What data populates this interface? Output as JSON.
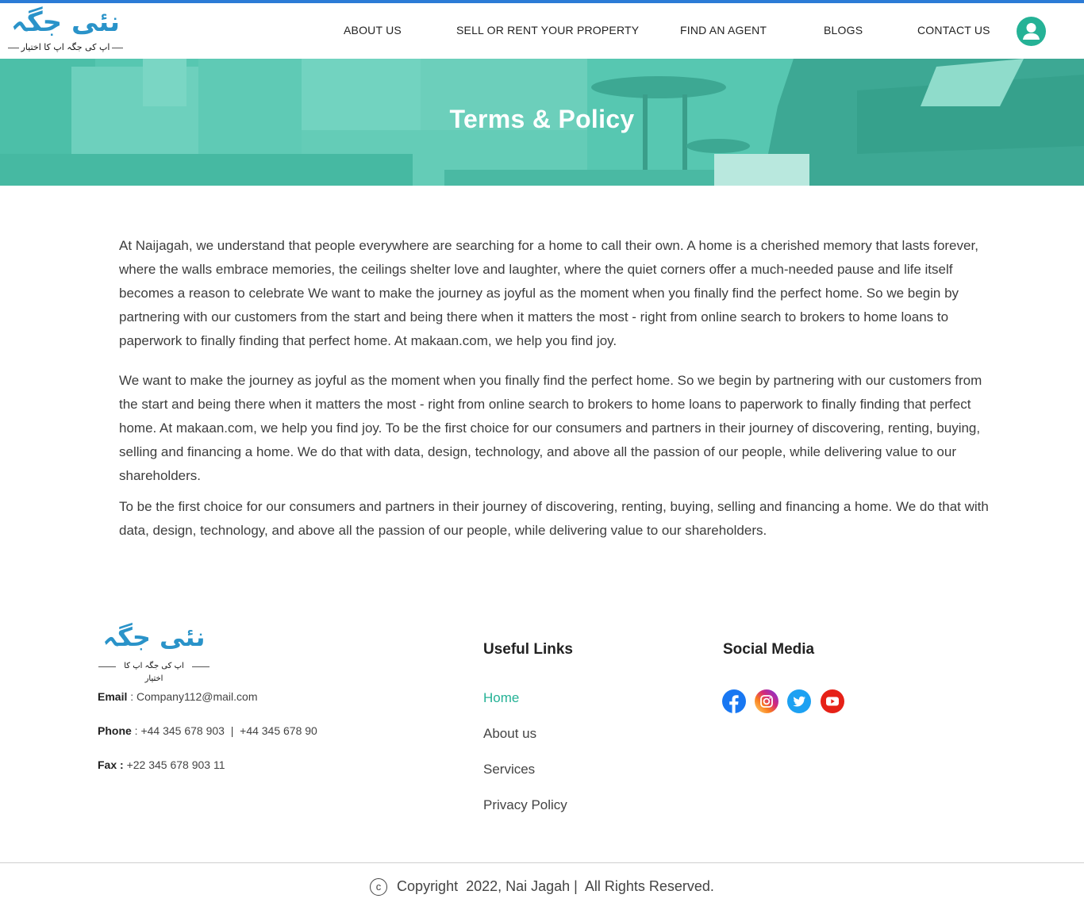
{
  "colors": {
    "brand_blue": "#2b7bd6",
    "logo_blue": "#2a93c9",
    "accent_teal": "#25b296",
    "hero_overlay": "#4fc4ad"
  },
  "header": {
    "logo": {
      "title_urdu": "نئی جگہ",
      "tagline_urdu": "اپ کی جگہ اپ کا اختیار"
    },
    "nav": [
      {
        "label": "ABOUT US"
      },
      {
        "label": "SELL OR RENT YOUR PROPERTY"
      },
      {
        "label": "FIND AN AGENT"
      },
      {
        "label": "BLOGS"
      },
      {
        "label": "CONTACT US"
      }
    ],
    "user_icon": "user-account-icon"
  },
  "hero": {
    "title": "Terms & Policy"
  },
  "content": {
    "paragraphs": [
      "At Naijagah, we understand that people everywhere are searching for a home to call their own. A home is a cherished memory that lasts forever, where the walls embrace memories, the ceilings shelter love and laughter, where the quiet corners offer a much-needed pause and life itself becomes a reason to celebrate We want to make the journey as joyful as the moment when you finally find the perfect home. So we begin by partnering with our customers from the start and being there when it matters the most - right from online search to brokers to home loans to paperwork to finally finding that perfect home. At makaan.com, we help you find joy.",
      "We want to make the journey as joyful as the moment when you finally find the perfect home. So we begin by partnering with our customers from the start and being there when it matters the most - right from online search to brokers to home loans to paperwork to finally finding that perfect home. At makaan.com, we help you find joy. To be the first choice for our consumers and partners in their journey of discovering, renting, buying, selling and financing a home. We do that with data, design, technology, and above all the passion of our people, while delivering value to our shareholders.",
      "To be the first choice for our consumers and partners in their journey of discovering, renting, buying, selling and financing a home. We do that with data, design, technology, and above all the passion of our people, while delivering value to our shareholders."
    ]
  },
  "footer": {
    "logo": {
      "title_urdu": "نئی جگہ",
      "tagline_urdu": "اپ کی جگہ اپ کا اختیار"
    },
    "contact": {
      "email_label": "Email",
      "email_value": " : Company112@mail.com",
      "phone_label": "Phone",
      "phone_value": " : +44 345 678 903  |  +44 345 678 90",
      "fax_label": "Fax :",
      "fax_value": " +22 345 678 903 11"
    },
    "useful_links": {
      "title": "Useful Links",
      "items": [
        {
          "label": "Home"
        },
        {
          "label": "About us"
        },
        {
          "label": "Services"
        },
        {
          "label": "Privacy Policy"
        }
      ]
    },
    "social_media": {
      "title": "Social Media",
      "icons": [
        "facebook-icon",
        "instagram-icon",
        "twitter-icon",
        "youtube-icon"
      ]
    },
    "copyright": {
      "symbol": "c",
      "text": "Copyright  2022, Nai Jagah |  All Rights Reserved."
    }
  }
}
